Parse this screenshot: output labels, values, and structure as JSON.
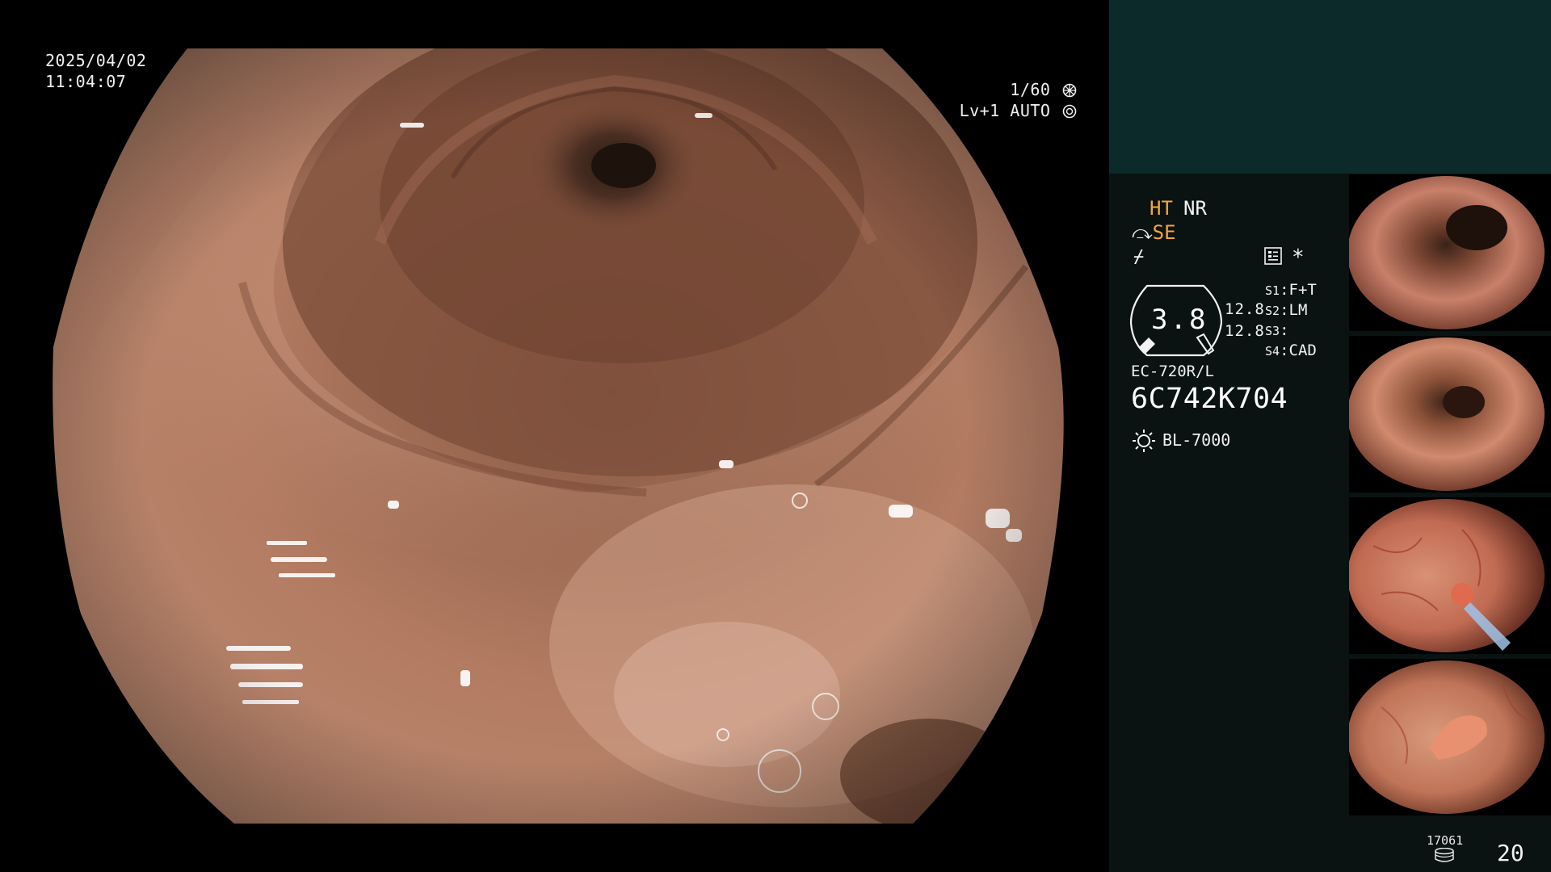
{
  "main": {
    "date": "2025/04/02",
    "time": "11:04:07",
    "shutter": "1/60",
    "level": "Lv+1",
    "iris": "AUTO"
  },
  "panel": {
    "mode_ht": "HT",
    "mode_nr": "NR",
    "mode_se": "SE",
    "gauge_value": "3.8",
    "gauge_num_1": "12.8",
    "gauge_num_2": "12.8",
    "slots": [
      {
        "key": "S1",
        "value": "F+T"
      },
      {
        "key": "S2",
        "value": "LM"
      },
      {
        "key": "S3",
        "value": ""
      },
      {
        "key": "S4",
        "value": "CAD"
      }
    ],
    "scope_model": "EC-720R/L",
    "scope_serial": "6C742K704",
    "light_source": "BL-7000",
    "counter_small": "17061",
    "counter_big": "20"
  },
  "colors": {
    "orange": "#f5a63a",
    "panel_bg": "#0a1212",
    "panel_top": "#0c2a2a"
  },
  "icons": [
    "shutter-icon",
    "iris-icon",
    "se-arrow-icon",
    "wave-icon",
    "menu-icon",
    "light-source-icon",
    "database-icon"
  ]
}
